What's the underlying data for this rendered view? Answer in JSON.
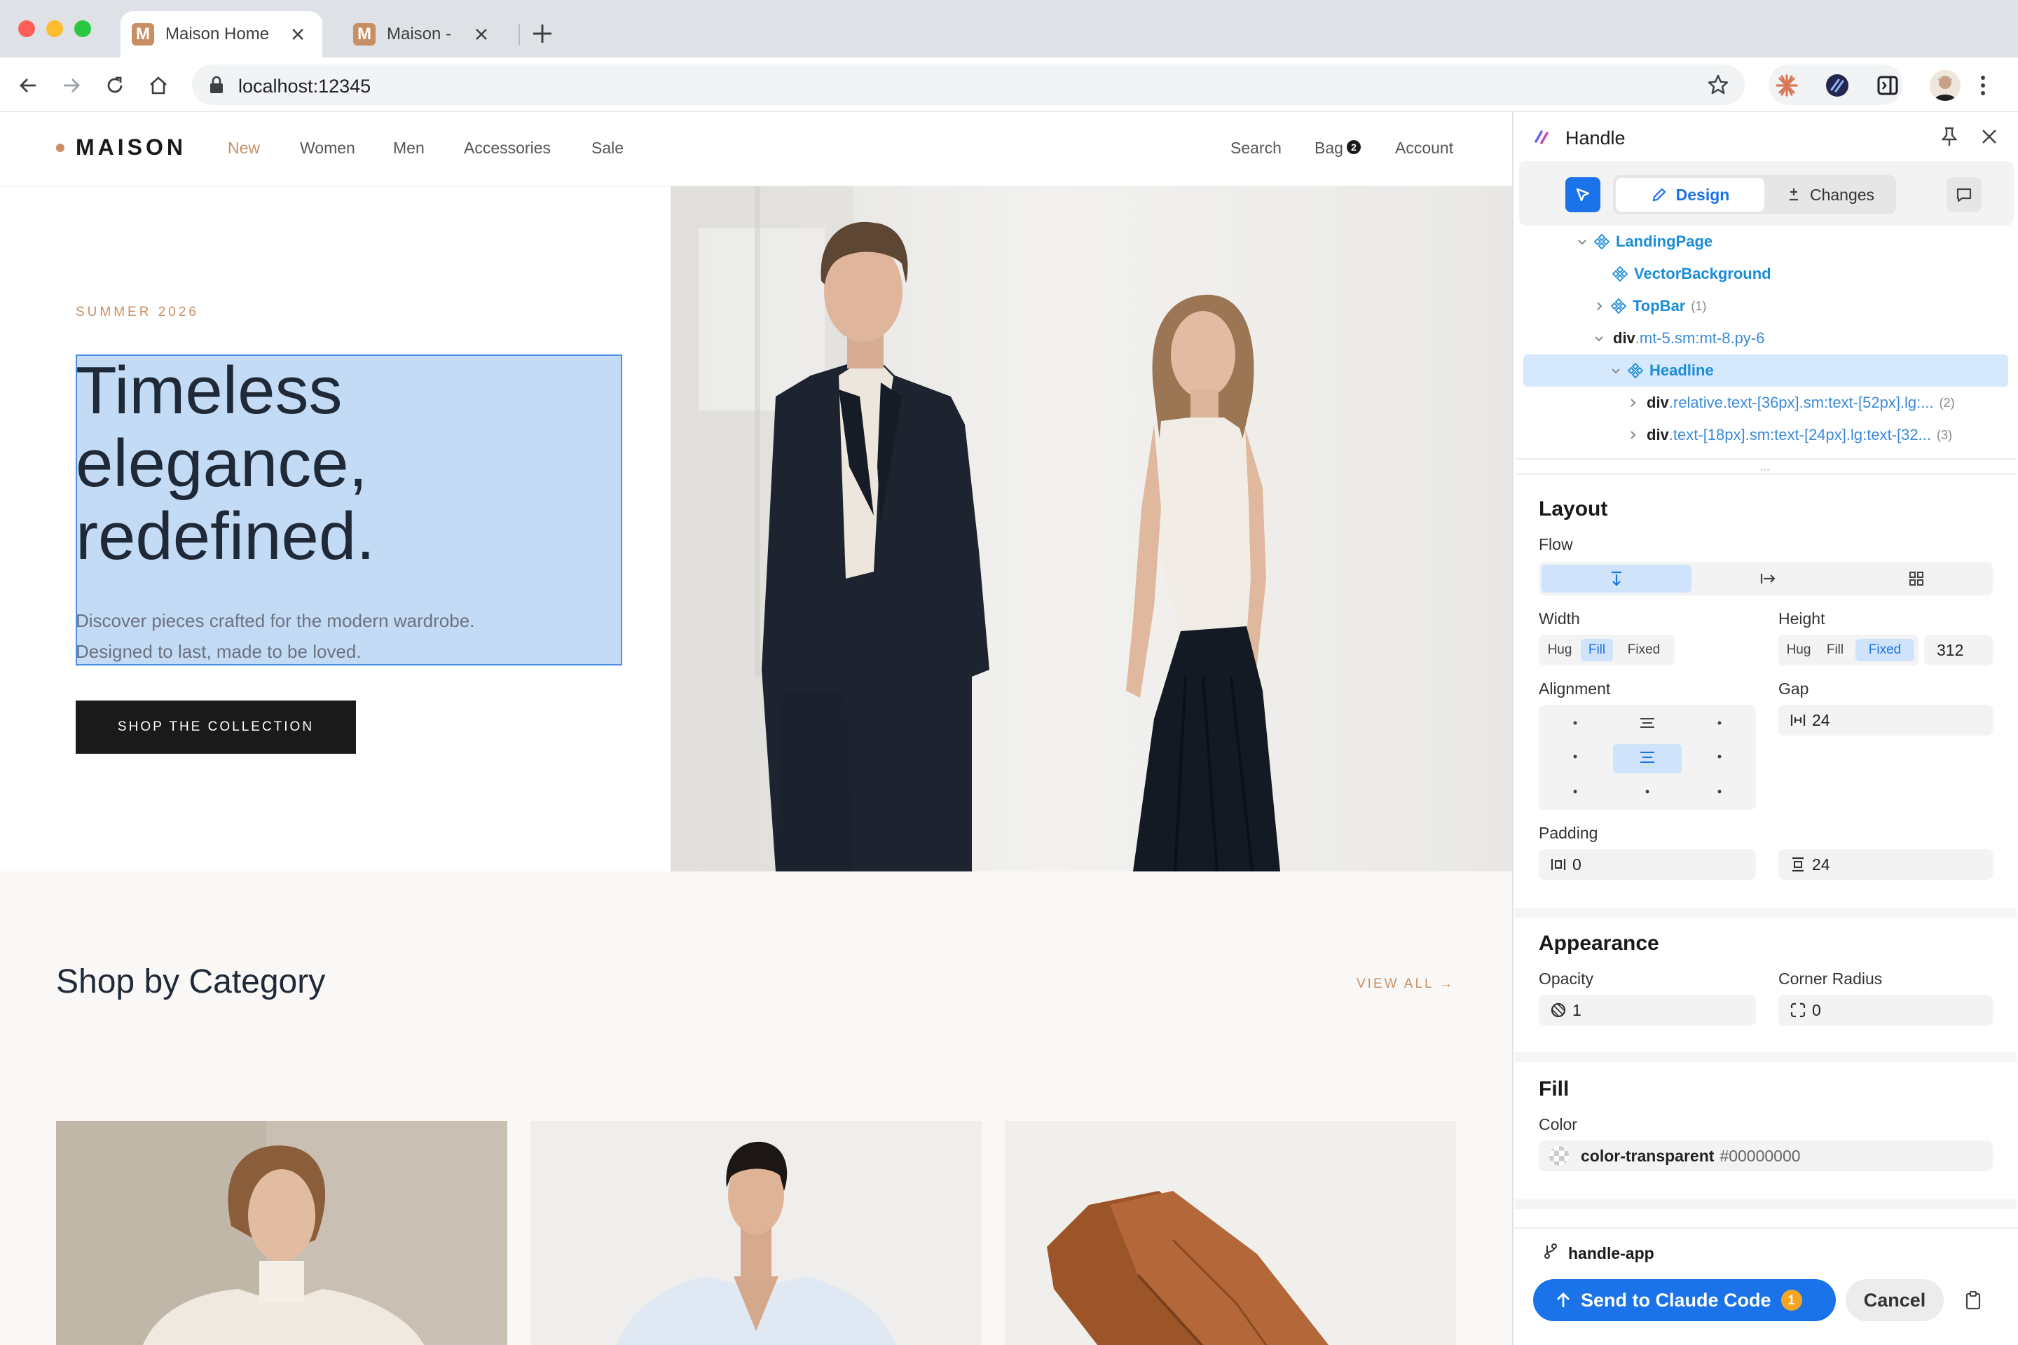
{
  "browser": {
    "tabs": [
      {
        "title": "Maison Home",
        "favicon": "M"
      },
      {
        "title": "Maison -",
        "favicon": "M"
      }
    ],
    "url": "localhost:12345"
  },
  "site": {
    "logo": "MAISON",
    "nav": [
      "New",
      "Women",
      "Men",
      "Accessories",
      "Sale"
    ],
    "right_nav": {
      "search": "Search",
      "bag": "Bag",
      "bag_count": "2",
      "account": "Account"
    },
    "hero": {
      "eyebrow": "SUMMER 2026",
      "headline": [
        "Timeless",
        "elegance,",
        "redefined."
      ],
      "subtext": [
        "Discover pieces crafted for the modern wardrobe.",
        "Designed to last, made to be loved."
      ],
      "cta": "SHOP THE COLLECTION"
    },
    "category": {
      "title": "Shop by Category",
      "view_all": "VIEW ALL →"
    },
    "colors": {
      "accent": "#c98f64",
      "dark": "#1a1a1a"
    }
  },
  "panel": {
    "title": "Handle",
    "tabs": {
      "design": "Design",
      "changes": "Changes"
    },
    "tree": [
      {
        "name": "LandingPage",
        "kind": "component",
        "expanded": true
      },
      {
        "name": "VectorBackground",
        "kind": "component"
      },
      {
        "name": "TopBar",
        "kind": "component",
        "count": "(1)"
      },
      {
        "tag": "div",
        "classes": ".mt-5.sm:mt-8.py-6",
        "kind": "element",
        "expanded": true
      },
      {
        "name": "Headline",
        "kind": "component",
        "selected": true
      },
      {
        "tag": "div",
        "classes": ".relative.text-[36px].sm:text-[52px].lg:...",
        "count": "(2)",
        "kind": "element"
      },
      {
        "tag": "div",
        "classes": ".text-[18px].sm:text-[24px].lg:text-[32...",
        "count": "(3)",
        "kind": "element"
      }
    ],
    "layout": {
      "title": "Layout",
      "flow_label": "Flow",
      "width_label": "Width",
      "height_label": "Height",
      "width_options": [
        "Hug",
        "Fill",
        "Fixed"
      ],
      "width_selected": "Fill",
      "height_options": [
        "Hug",
        "Fill",
        "Fixed"
      ],
      "height_selected": "Fixed",
      "height_value": "312",
      "alignment_label": "Alignment",
      "gap_label": "Gap",
      "gap_value": "24",
      "padding_label": "Padding",
      "padding_h": "0",
      "padding_v": "24"
    },
    "appearance": {
      "title": "Appearance",
      "opacity_label": "Opacity",
      "opacity": "1",
      "radius_label": "Corner Radius",
      "radius": "0"
    },
    "fill": {
      "title": "Fill",
      "color_label": "Color",
      "color_name": "color-transparent",
      "color_hex": "#00000000"
    },
    "footer": {
      "branch": "handle-app",
      "send": "Send to Claude Code",
      "send_count": "1",
      "cancel": "Cancel"
    }
  }
}
